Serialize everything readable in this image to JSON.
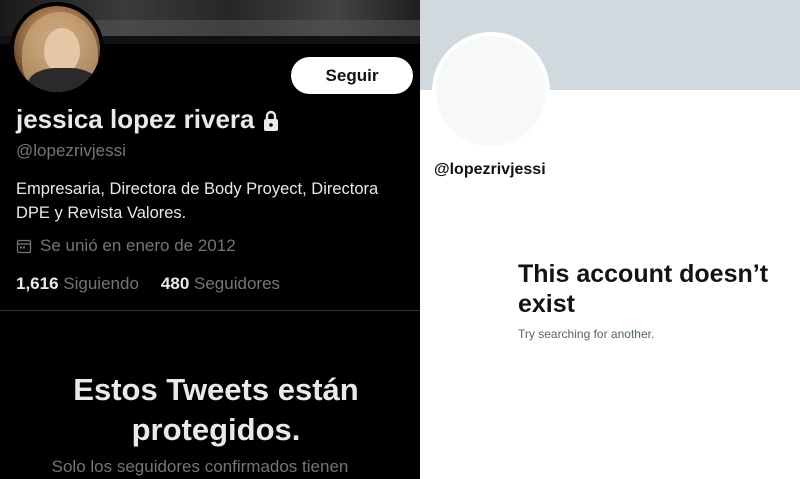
{
  "left_profile": {
    "follow_label": "Seguir",
    "display_name": "jessica lopez rivera",
    "handle": "@lopezrivjessi",
    "bio": "Empresaria, Directora de Body Proyect, Directora DPE y Revista Valores.",
    "joined": "Se unió en enero de 2012",
    "following_count": "1,616",
    "following_label": "Siguiendo",
    "followers_count": "480",
    "followers_label": "Seguidores",
    "protected_title": "Estos Tweets están protegidos.",
    "protected_sub": "Solo los seguidores confirmados tienen"
  },
  "right_profile": {
    "handle": "@lopezrivjessi",
    "title": "This account doesn’t exist",
    "subtitle": "Try searching for another."
  },
  "colors": {
    "dark_bg": "#000000",
    "dark_text": "#e7e9ea",
    "dark_muted": "#71767b",
    "light_bg": "#ffffff",
    "light_banner": "#cfd9de",
    "light_text": "#0f1419",
    "light_muted": "#536471"
  },
  "icons": {
    "lock": "lock-icon",
    "calendar": "calendar-icon"
  }
}
